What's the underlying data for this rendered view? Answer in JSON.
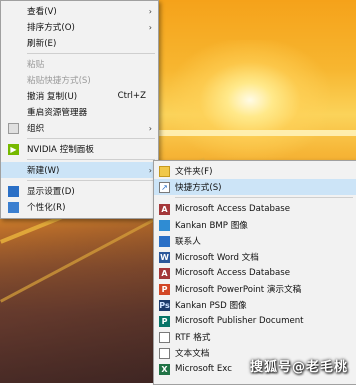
{
  "context_menu": {
    "items": [
      {
        "label": "查看(V)",
        "arrow": "›"
      },
      {
        "label": "排序方式(O)",
        "arrow": "›"
      },
      {
        "label": "刷新(E)"
      },
      {
        "label": "粘贴"
      },
      {
        "label": "粘贴快捷方式(S)"
      },
      {
        "label": "撤消 复制(U)",
        "shortcut": "Ctrl+Z"
      },
      {
        "label": "重启资源管理器"
      },
      {
        "label": "组织",
        "arrow": "›"
      },
      {
        "label": "NVIDIA 控制面板"
      },
      {
        "label": "新建(W)",
        "arrow": "›"
      },
      {
        "label": "显示设置(D)"
      },
      {
        "label": "个性化(R)"
      }
    ]
  },
  "new_submenu": {
    "items": [
      {
        "label": "文件夹(F)"
      },
      {
        "label": "快捷方式(S)"
      },
      {
        "label": "Microsoft Access Database"
      },
      {
        "label": "Kankan BMP 图像"
      },
      {
        "label": "联系人"
      },
      {
        "label": "Microsoft Word 文档"
      },
      {
        "label": "Microsoft Access Database"
      },
      {
        "label": "Microsoft PowerPoint 演示文稿"
      },
      {
        "label": "Kankan PSD 图像"
      },
      {
        "label": "Microsoft Publisher Document"
      },
      {
        "label": "RTF 格式"
      },
      {
        "label": "文本文档"
      },
      {
        "label": "Microsoft Exc"
      }
    ]
  },
  "icons": {
    "nvidia": "nvidia-icon",
    "display": "display-icon",
    "personalize": "personalize-icon",
    "organize": "organize-icon",
    "folder": "folder-icon",
    "shortcut": "shortcut-icon",
    "access": "access-icon",
    "bmp": "image-icon",
    "contact": "contact-icon",
    "word": "word-icon",
    "powerpoint": "powerpoint-icon",
    "psd": "psd-icon",
    "publisher": "publisher-icon",
    "rtf": "rtf-icon",
    "text": "text-document-icon",
    "excel": "excel-icon"
  },
  "watermark": "搜狐号@老毛桃"
}
